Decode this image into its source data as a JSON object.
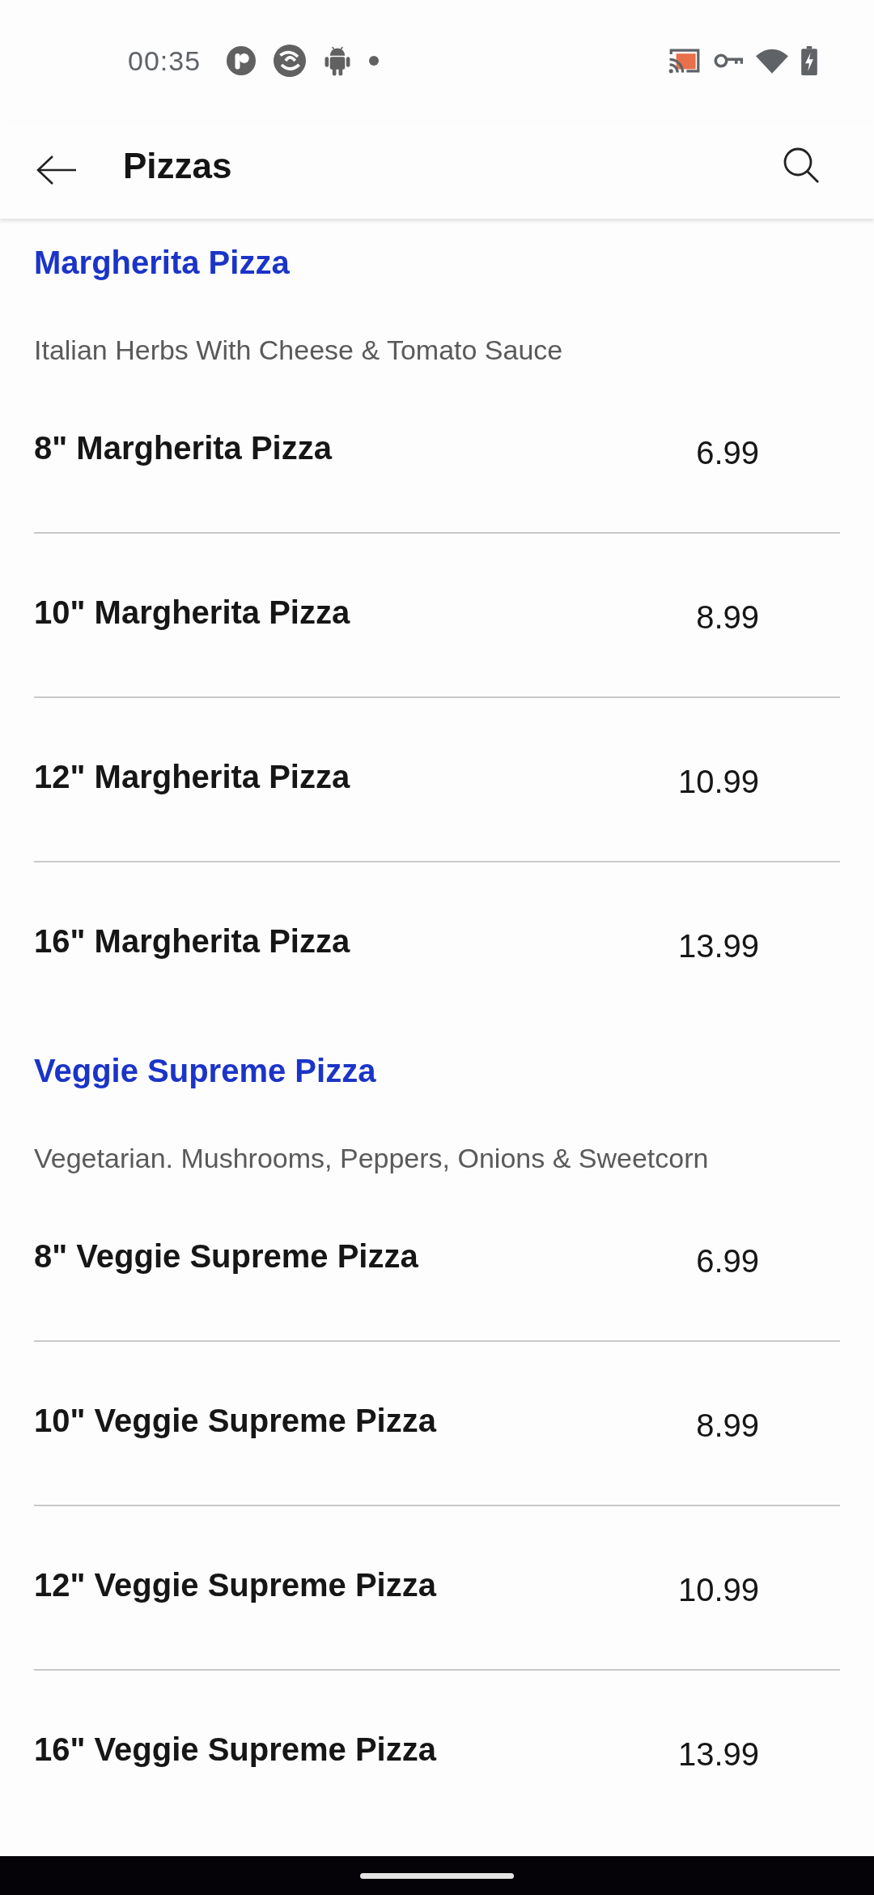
{
  "status_bar": {
    "time": "00:35"
  },
  "app_bar": {
    "title": "Pizzas"
  },
  "sections": [
    {
      "title": "Margherita Pizza",
      "description": "Italian Herbs With Cheese & Tomato Sauce",
      "items": [
        {
          "name": "8\" Margherita Pizza",
          "price": "6.99"
        },
        {
          "name": "10\" Margherita Pizza",
          "price": "8.99"
        },
        {
          "name": "12\" Margherita Pizza",
          "price": "10.99"
        },
        {
          "name": "16\" Margherita Pizza",
          "price": "13.99"
        }
      ]
    },
    {
      "title": "Veggie Supreme Pizza",
      "description": "Vegetarian. Mushrooms, Peppers, Onions & Sweetcorn",
      "items": [
        {
          "name": "8\" Veggie Supreme Pizza",
          "price": "6.99"
        },
        {
          "name": "10\" Veggie Supreme Pizza",
          "price": "8.99"
        },
        {
          "name": "12\" Veggie Supreme Pizza",
          "price": "10.99"
        },
        {
          "name": "16\" Veggie Supreme Pizza",
          "price": "13.99"
        }
      ]
    }
  ]
}
